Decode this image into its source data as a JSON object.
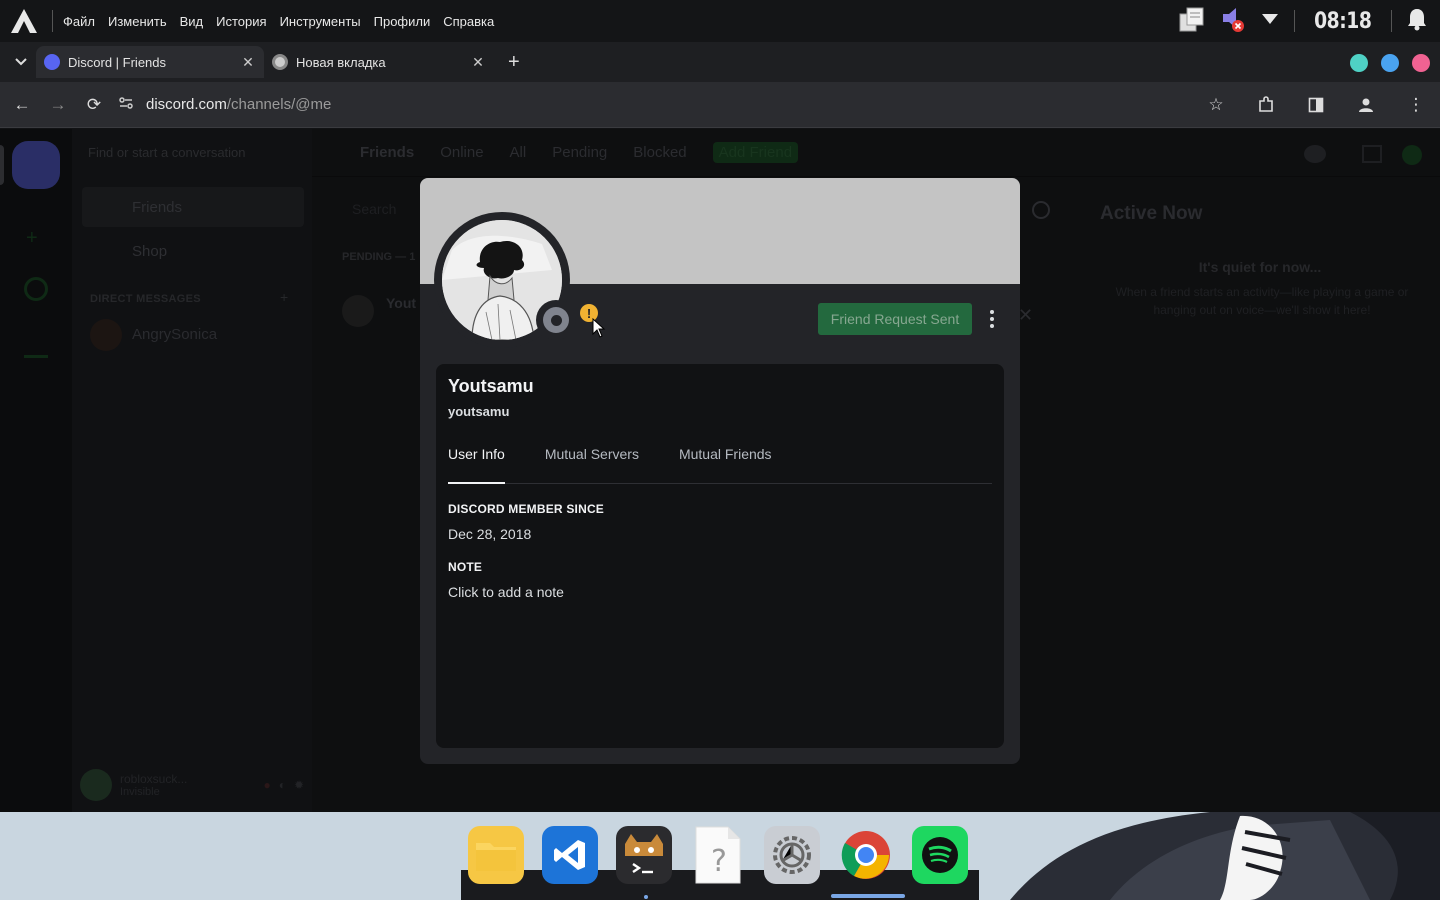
{
  "menu": [
    "Файл",
    "Изменить",
    "Вид",
    "История",
    "Инструменты",
    "Профили",
    "Справка"
  ],
  "clock": "08:18",
  "tabs": [
    {
      "title": "Discord | Friends",
      "active": true
    },
    {
      "title": "Новая вкладка",
      "active": false
    }
  ],
  "url": {
    "host": "discord.com",
    "path": "/channels/@me"
  },
  "background": {
    "dm_search": "Find or start a conversation",
    "dm_friends": "Friends",
    "dm_shop": "Shop",
    "direct_messages": "DIRECT MESSAGES",
    "dm_user": "AngrySonica",
    "header_title": "Friends",
    "header_tabs": [
      "Online",
      "All",
      "Pending",
      "Blocked"
    ],
    "header_add": "Add Friend",
    "search": "Search",
    "pending_label": "PENDING — 1",
    "pending_user": "Yout",
    "active_now": "Active Now",
    "quiet_title": "It's quiet for now...",
    "quiet_sub": "When a friend starts an activity—like playing a game or hanging out on voice—we'll show it here!",
    "panel_user": "robloxsuck...",
    "panel_status": "Invisible"
  },
  "profile": {
    "display_name": "Youtsamu",
    "username": "youtsamu",
    "request_button": "Friend Request Sent",
    "tabs": [
      "User Info",
      "Mutual Servers",
      "Mutual Friends"
    ],
    "member_since_title": "DISCORD MEMBER SINCE",
    "member_since": "Dec 28, 2018",
    "note_title": "NOTE",
    "note_placeholder": "Click to add a note"
  },
  "colors": {
    "banner": "#c4c4c4",
    "button": "#248046",
    "status_offline": "#80848e",
    "warn": "#f0b232"
  },
  "dock": [
    "files-icon",
    "vscode-icon",
    "terminal-icon",
    "unknown-file-icon",
    "settings-icon",
    "chrome-icon",
    "spotify-icon"
  ]
}
